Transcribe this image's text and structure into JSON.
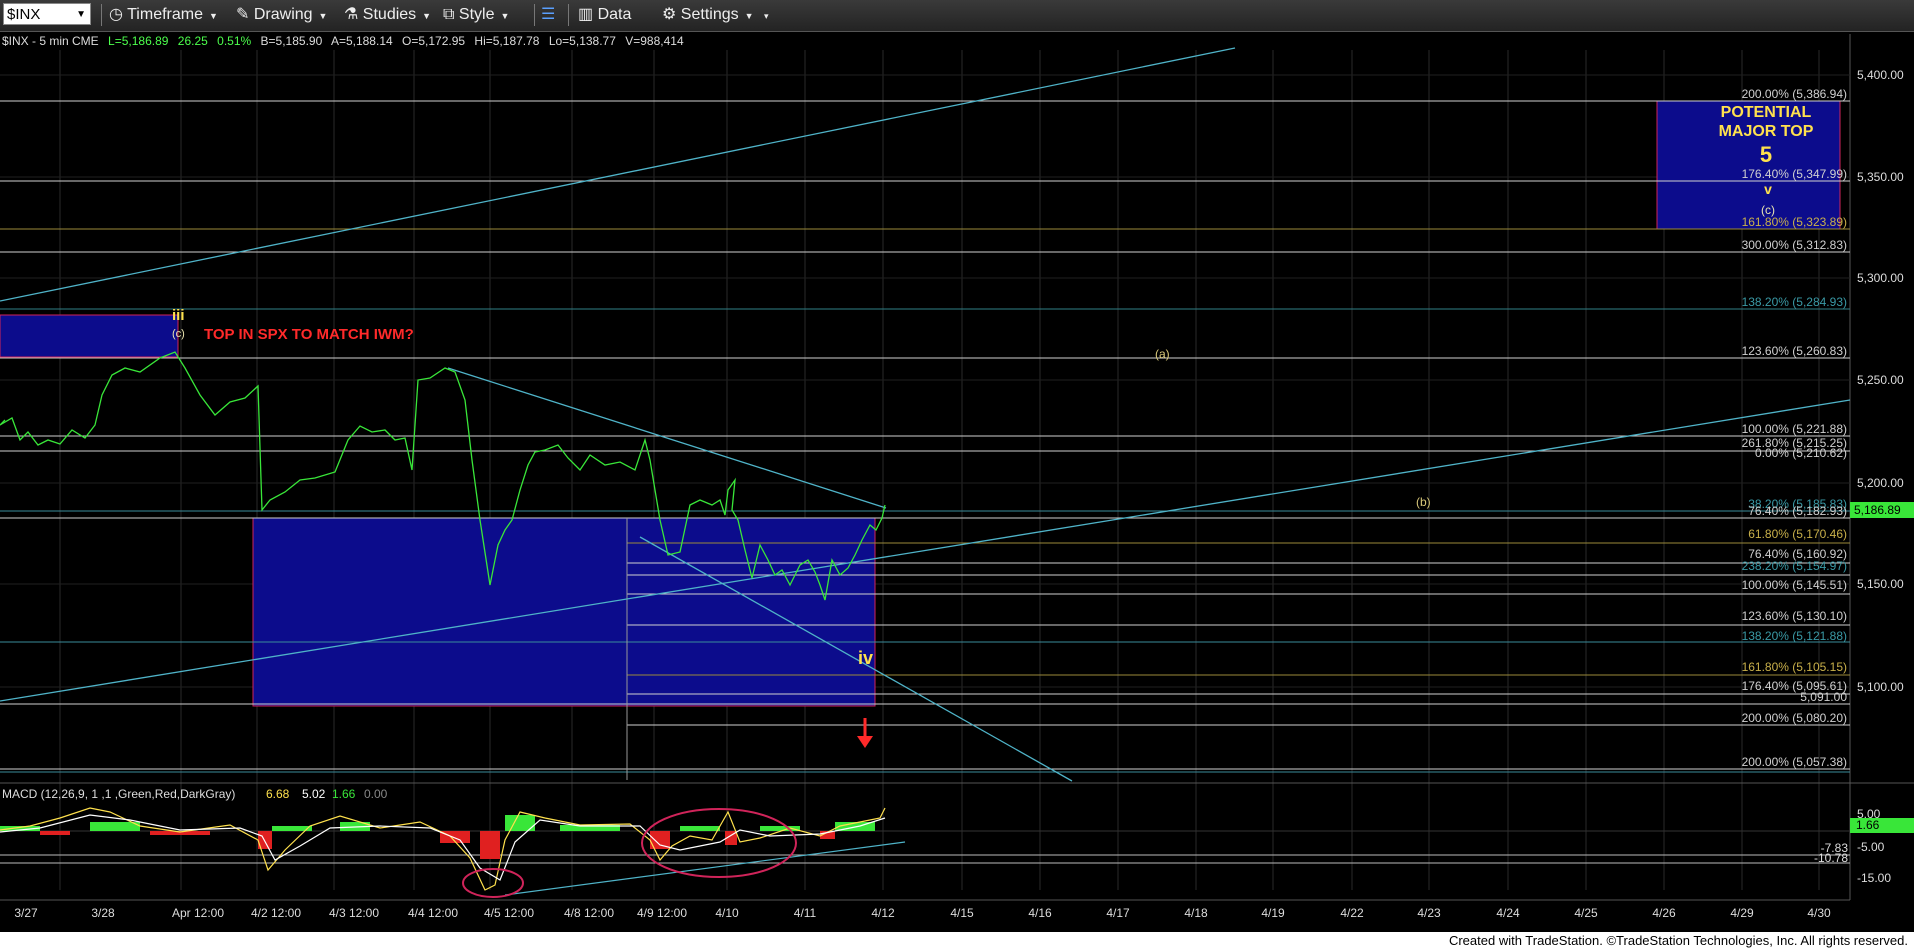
{
  "toolbar": {
    "symbol": "$INX",
    "timeframe": "Timeframe",
    "drawing": "Drawing",
    "studies": "Studies",
    "style": "Style",
    "data": "Data",
    "settings": "Settings"
  },
  "info_bar": {
    "symbol": "$INX - 5 min  CME",
    "last": "L=5,186.89",
    "change": "26.25",
    "change_pct": "0.51%",
    "bid": "B=5,185.90",
    "ask": "A=5,188.14",
    "open": "O=5,172.95",
    "high": "Hi=5,187.78",
    "low": "Lo=5,138.77",
    "volume": "V=988,414"
  },
  "price_axis": {
    "ticks": [
      "5,400.00",
      "5,350.00",
      "5,300.00",
      "5,250.00",
      "5,200.00",
      "5,150.00",
      "5,100.00"
    ],
    "last_price": "5,186.89"
  },
  "macd": {
    "label": "MACD (12,26,9, 1 ,1 ,Green,Red,DarkGray)",
    "macd_value": "6.68",
    "signal_value": "5.02",
    "hist_value": "1.66",
    "zero_value": "0.00",
    "axis_ticks": [
      "5.00",
      "-5.00",
      "-15.00"
    ],
    "hist_badge": "1.66",
    "extra_labels": [
      "-7.83",
      "-10.78"
    ]
  },
  "time_axis": {
    "labels": [
      "3/27",
      "3/28",
      "Apr 12:00",
      "4/2 12:00",
      "4/3 12:00",
      "4/4 12:00",
      "4/5 12:00",
      "4/8 12:00",
      "4/9 12:00",
      "4/10",
      "4/11",
      "4/12",
      "4/15",
      "4/16",
      "4/17",
      "4/18",
      "4/19",
      "4/22",
      "4/23",
      "4/24",
      "4/25",
      "4/26",
      "4/29",
      "4/30"
    ]
  },
  "fib_levels": [
    "200.00% (5,386.94)",
    "176.40% (5,347.99)",
    "161.80% (5,323.89)",
    "300.00% (5,312.83)",
    "138.20% (5,284.93)",
    "123.60% (5,260.83)",
    "100.00% (5,221.88)",
    "261.80% (5,215.25)",
    "0.00% (5,210.62)",
    "38.20% (5,185.83)",
    "76.40% (5,182.93)",
    "61.80% (5,170.46)",
    "76.40% (5,160.92)",
    "238.20% (5,154.97)",
    "100.00% (5,145.51)",
    "123.60% (5,130.10)",
    "138.20% (5,121.88)",
    "161.80% (5,105.15)",
    "176.40% (5,095.61)",
    "5,091.00",
    "200.00% (5,080.20)",
    "200.00% (5,057.38)"
  ],
  "annotations": {
    "top_box_line1": "POTENTIAL",
    "top_box_line2": "MAJOR TOP",
    "top_box_5": "5",
    "top_box_v": "v",
    "top_box_c": "(c)",
    "wave_iii": "iii",
    "wave_c_left": "(c)",
    "red_note": "TOP IN SPX TO MATCH IWM?",
    "wave_a": "(a)",
    "wave_b": "(b)",
    "wave_iv": "iv"
  },
  "footer": {
    "credit": "Created with TradeStation. ©TradeStation Technologies, Inc. All rights reserved."
  },
  "colors": {
    "price_line": "#39e639",
    "box_fill": "#0c0c8c",
    "box_border": "#d0245a",
    "trendline": "#4fb3c8",
    "fib_white": "#d8d8d8",
    "fib_yellow": "#c9b04a",
    "red_text": "#ff2a2a",
    "yellow_text": "#ffe14d"
  }
}
